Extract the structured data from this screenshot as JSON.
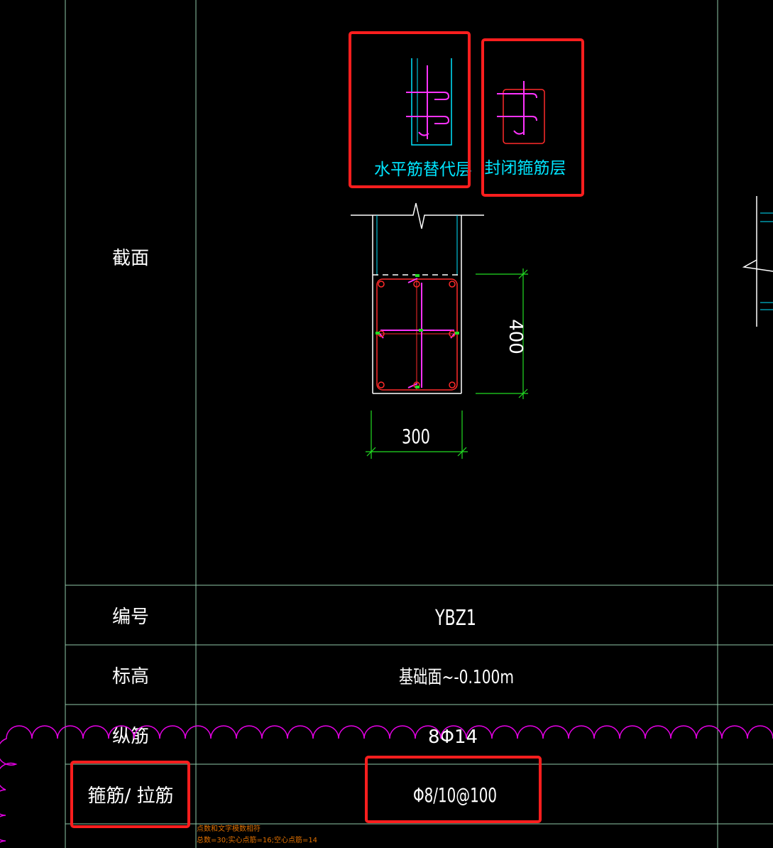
{
  "legend": {
    "horizontal_label": "水平筋替代层",
    "closed_label": "封闭箍筋层"
  },
  "table": {
    "row_labels": {
      "section": "截面",
      "id": "编号",
      "elevation": "标高",
      "longitudinal": "纵筋",
      "stirrup": "箍筋/ 拉筋"
    },
    "values": {
      "id": "YBZ1",
      "elevation": "基础面~-0.100m",
      "longitudinal": "8Φ14",
      "stirrup": "Φ8/10@100"
    }
  },
  "dimensions": {
    "width": "300",
    "height": "400"
  },
  "footnote": {
    "line1": "点数和文字模数相符",
    "line2": "总数=30;实心点筋=16;空心点筋=14"
  },
  "colors": {
    "grid": "#8fc8a8",
    "white": "#ffffff",
    "cyan": "#00e5ff",
    "magenta": "#ff33ff",
    "red": "#ff2a2a",
    "green": "#22dd22",
    "highlight": "#ff1e1e",
    "cloud": "#e600e6",
    "footnote": "#e07000"
  }
}
